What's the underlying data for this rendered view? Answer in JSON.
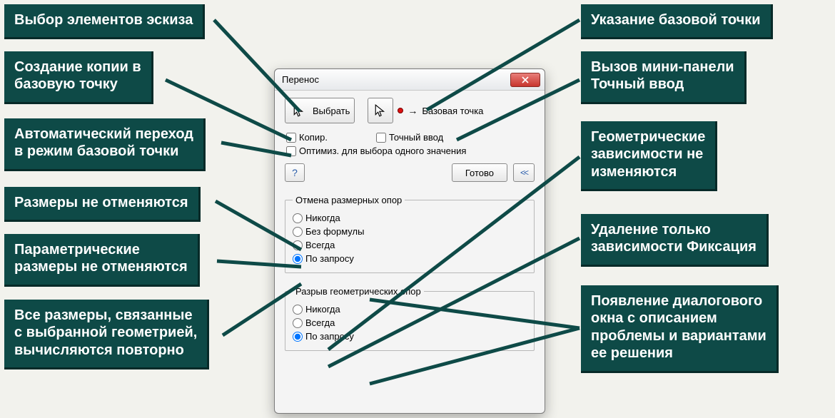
{
  "dialog": {
    "title": "Перенос",
    "select_label": "Выбрать",
    "basepoint_label": "Базовая точка",
    "copy_label": "Копир.",
    "precise_label": "Точный ввод",
    "optimize_label": "Оптимиз. для выбора одного значения",
    "done_label": "Готово",
    "chevrons": "<<",
    "group1": {
      "legend": "Отмена размерных опор",
      "r1": "Никогда",
      "r2": "Без формулы",
      "r3": "Всегда",
      "r4": "По запросу"
    },
    "group2": {
      "legend": "Разрыв геометрических опор",
      "r1": "Никогда",
      "r2": "Всегда",
      "r3": "По запросу"
    }
  },
  "annotations": {
    "l1": "Выбор элементов эскиза",
    "l2": "Создание копии в\nбазовую точку",
    "l3": "Автоматический переход\nв режим базовой точки",
    "l4": "Размеры не отменяются",
    "l5": "Параметрические\nразмеры не отменяются",
    "l6": "Все  размеры, связанные\nс выбранной геометрией,\nвычисляются повторно",
    "r1": "Указание базовой точки",
    "r2": "Вызов мини-панели\nТочный ввод",
    "r3": "Геометрические\nзависимости не\nизменяются",
    "r4": "Удаление только\nзависимости Фиксация",
    "r5": "Появление диалогового\nокна с описанием\nпроблемы и вариантами\nее решения"
  }
}
